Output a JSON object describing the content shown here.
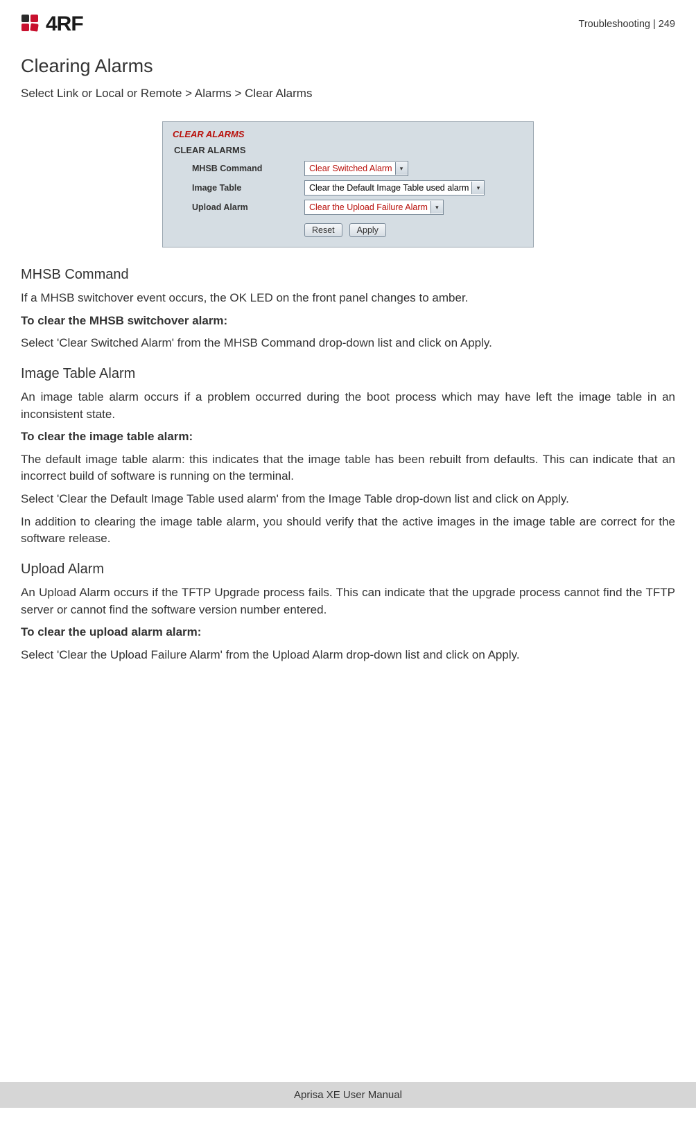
{
  "header": {
    "logo_text": "4RF",
    "crumb": "Troubleshooting  |  249"
  },
  "title": "Clearing Alarms",
  "nav_path": "Select Link or Local or Remote > Alarms > Clear Alarms",
  "panel": {
    "title": "CLEAR ALARMS",
    "subtitle": "CLEAR ALARMS",
    "rows": [
      {
        "label": "MHSB Command",
        "value": "Clear Switched Alarm",
        "red": true
      },
      {
        "label": "Image Table",
        "value": "Clear the Default Image Table used alarm",
        "red": false
      },
      {
        "label": "Upload Alarm",
        "value": "Clear the Upload Failure Alarm",
        "red": true
      }
    ],
    "reset": "Reset",
    "apply": "Apply"
  },
  "sections": [
    {
      "heading": "MHSB Command",
      "paras": [
        {
          "text": "If a MHSB switchover event occurs, the OK LED on the front panel changes to amber.",
          "bold": false
        },
        {
          "text": "To clear the MHSB switchover alarm:",
          "bold": true
        },
        {
          "text": "Select 'Clear Switched Alarm' from the MHSB Command drop-down list and click on Apply.",
          "bold": false
        }
      ]
    },
    {
      "heading": "Image Table Alarm",
      "paras": [
        {
          "text": "An image table alarm occurs if a problem occurred during the boot process which may have left the image table in an inconsistent state.",
          "bold": false
        },
        {
          "text": "To clear the image table alarm:",
          "bold": true
        },
        {
          "text": "The default image table alarm: this indicates that the image table has been rebuilt from defaults. This can indicate that an incorrect build of software is running on the terminal.",
          "bold": false
        },
        {
          "text": "Select 'Clear the Default Image Table used alarm' from the Image Table drop-down list and click on Apply.",
          "bold": false
        },
        {
          "text": "In addition to clearing the image table alarm, you should verify that the active images in the image table are correct for the software release.",
          "bold": false
        }
      ]
    },
    {
      "heading": "Upload Alarm",
      "paras": [
        {
          "text": "An Upload Alarm occurs if the TFTP Upgrade process fails. This can indicate that the upgrade process cannot find the TFTP server or cannot find the software version number entered.",
          "bold": false
        },
        {
          "text": "To clear the upload alarm alarm:",
          "bold": true
        },
        {
          "text": "Select 'Clear the Upload Failure Alarm' from the Upload Alarm drop-down list and click on Apply.",
          "bold": false
        }
      ]
    }
  ],
  "footer": "Aprisa XE User Manual"
}
